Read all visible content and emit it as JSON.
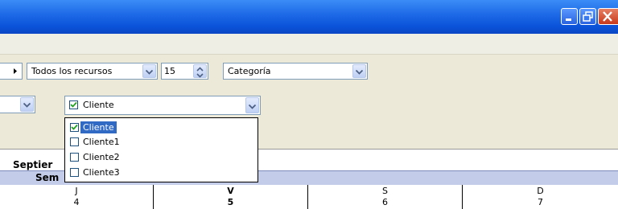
{
  "toolbar": {
    "resource_select": "Todos los recursos",
    "count_value": "15",
    "category_select": "Categoría"
  },
  "filter": {
    "client_select": "Cliente",
    "client_checked": true
  },
  "dropdown": {
    "options": [
      {
        "label": "Cliente",
        "checked": true,
        "selected": true
      },
      {
        "label": "Cliente1",
        "checked": false,
        "selected": false
      },
      {
        "label": "Cliente2",
        "checked": false,
        "selected": false
      },
      {
        "label": "Cliente3",
        "checked": false,
        "selected": false
      }
    ]
  },
  "calendar": {
    "month_label": "Septier",
    "week_label": "Sem",
    "days": [
      {
        "name": "J",
        "num": "4",
        "bold": false
      },
      {
        "name": "V",
        "num": "5",
        "bold": true
      },
      {
        "name": "S",
        "num": "6",
        "bold": false
      },
      {
        "name": "D",
        "num": "7",
        "bold": false
      }
    ]
  },
  "colors": {
    "titlebar": "#0A52D8",
    "selection": "#316AC5",
    "week_bar": "#C3CCE9"
  }
}
